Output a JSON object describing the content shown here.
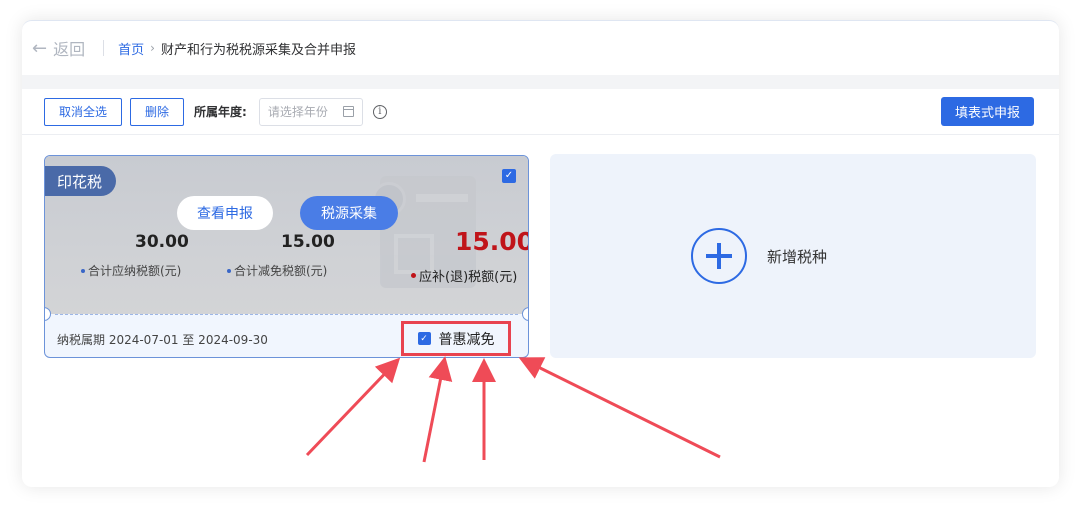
{
  "header": {
    "back_label": "返回",
    "breadcrumb_home": "首页",
    "breadcrumb_separator": "›",
    "breadcrumb_current": "财产和行为税税源采集及合并申报"
  },
  "toolbar": {
    "cancel_all_label": "取消全选",
    "delete_label": "删除",
    "year_label": "所属年度:",
    "year_placeholder": "请选择年份",
    "info_icon": "i",
    "submit_label": "填表式申报"
  },
  "tax_card": {
    "tag": "印花税",
    "checked": true,
    "check_glyph": "✓",
    "view_label": "查看申报",
    "collect_label": "税源采集",
    "amount_payable": "30.00",
    "amount_payable_caption": "合计应纳税额(元)",
    "amount_relief": "15.00",
    "amount_relief_caption": "合计减免税额(元)",
    "amount_due": "15.00",
    "amount_due_caption": "应补(退)税额(元)",
    "period": "纳税属期 2024-07-01 至 2024-09-30",
    "discount_label": "普惠减免",
    "discount_checked": true
  },
  "add_card": {
    "label": "新增税种",
    "icon": "plus-circle-icon"
  },
  "colors": {
    "primary": "#2d6ae3",
    "due_red": "#c0141a",
    "highlight": "#e8434f"
  }
}
